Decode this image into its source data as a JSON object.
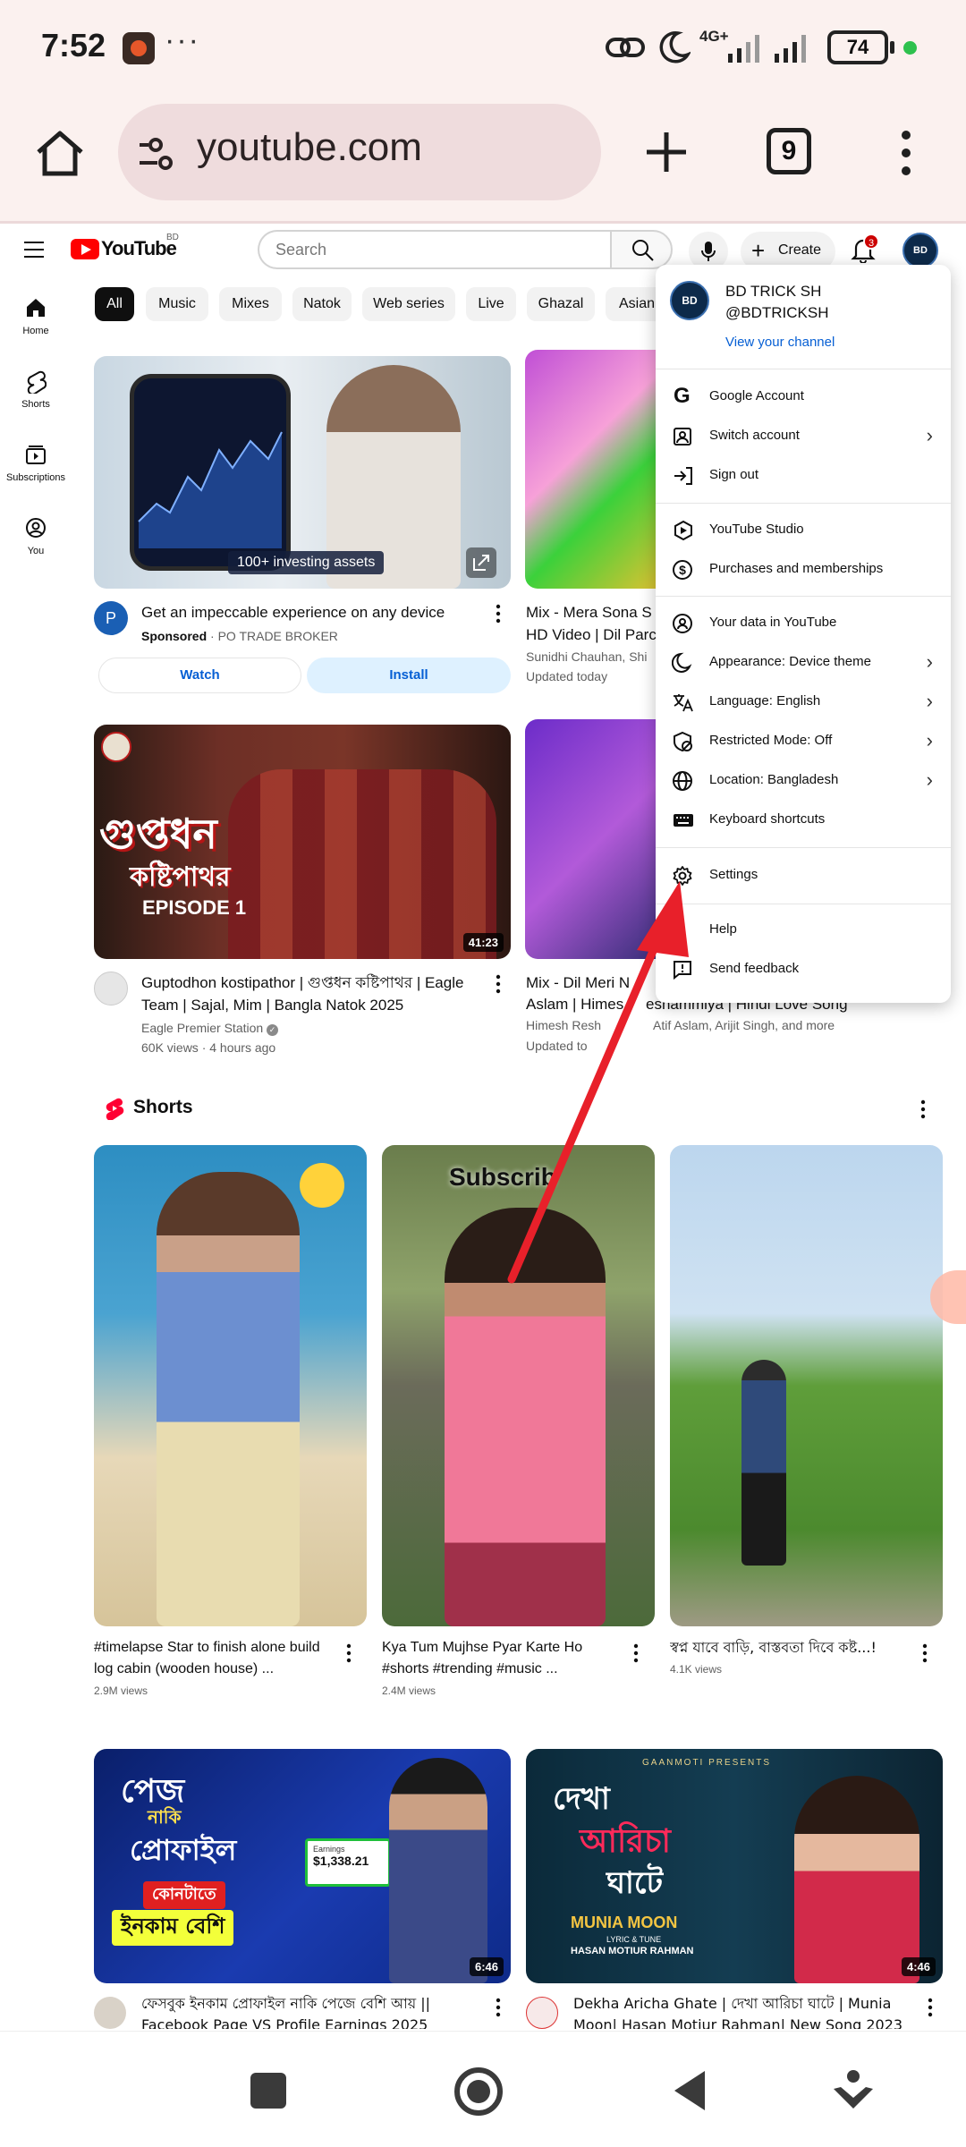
{
  "status": {
    "time": "7:52",
    "dots": "···",
    "network": "4G+",
    "battery": "74"
  },
  "chrome": {
    "url": "youtube.com",
    "tab_count": "9"
  },
  "yt": {
    "brand": "YouTube",
    "region": "BD",
    "search_placeholder": "Search",
    "create_label": "Create",
    "notif_count": "3",
    "avatar_text": "BD",
    "colors": {
      "brand_red": "#ff0000",
      "link_blue": "#065fd4",
      "arrow_red": "#e8202a"
    }
  },
  "sidenav": [
    {
      "label": "Home"
    },
    {
      "label": "Shorts"
    },
    {
      "label": "Subscriptions"
    },
    {
      "label": "You"
    }
  ],
  "chips": [
    "All",
    "Music",
    "Mixes",
    "Natok",
    "Web series",
    "Live",
    "Ghazal",
    "Asian"
  ],
  "videos": {
    "ad": {
      "thumb_caption": "100+ investing assets",
      "title": "Get an impeccable experience on any device",
      "sponsored": "Sponsored",
      "advertiser": "PO TRADE BROKER",
      "channel_initial": "P",
      "watch": "Watch",
      "install": "Install"
    },
    "mix1": {
      "title_l1": "Mix - Mera Sona S",
      "title_l2": "HD Video | Dil Parc",
      "meta_l1": "Sunidhi Chauhan, Shi",
      "meta_l2": "Updated today"
    },
    "natok": {
      "thumb_title": "গুপ্তধন",
      "thumb_sub": "কষ্টিপাথর",
      "episode": "EPISODE 1",
      "duration": "41:23",
      "title": "Guptodhon kostipathor | গুপ্তধন কষ্টিপাথর | Eagle Team | Sajal, Mim | Bangla Natok 2025",
      "channel": "Eagle Premier Station",
      "meta": "60K views · 4 hours ago"
    },
    "mix2": {
      "title_l1": "Mix - Dil Meri N",
      "title_l2": "Aslam | Himes",
      "title_tail": "eshammiya | Hindi Love Song",
      "meta_l1": "Himesh Resh",
      "meta_l1_tail": "Atif Aslam, Arijit Singh, and more",
      "meta_l2": "Updated to"
    }
  },
  "shorts": {
    "heading": "Shorts",
    "items": [
      {
        "title": "#timelapse Star to finish alone build log cabin (wooden house) ...",
        "views": "2.9M views"
      },
      {
        "title": "Kya Tum Mujhse Pyar Karte Ho #shorts #trending #music ...",
        "views": "2.4M views",
        "overlay": "Subscrib"
      },
      {
        "title": "স্বপ্ন যাবে বাড়ি, বাস্তবতা দিবে কষ্ট...!",
        "views": "4.1K views"
      }
    ]
  },
  "bottom_videos": [
    {
      "thumb_l1": "পেজ",
      "thumb_l2": "নাকি",
      "thumb_l3": "প্রোফাইল",
      "thumb_l4": "কোনটাতে",
      "thumb_l5": "ইনকাম বেশি",
      "earnings_label": "Earnings",
      "earnings": "$1,338.21",
      "duration": "6:46",
      "title_l1": "ফেসবুক ইনকাম প্রোফাইল নাকি পেজে বেশি আয় ||",
      "title_l2": "Facebook Page VS Profile Earnings 2025"
    },
    {
      "presents": "GAANMOTI PRESENTS",
      "thumb_l1": "দেখা",
      "thumb_l2": "আরিচা",
      "thumb_l3": "ঘাটে",
      "artist": "MUNIA MOON",
      "credit_label": "LYRIC & TUNE",
      "credit": "HASAN MOTIUR RAHMAN",
      "duration": "4:46",
      "title_l1": "Dekha Aricha Ghate | দেখা আরিচা ঘাটে | Munia",
      "title_l2": "Moon| Hasan Motiur Rahman| New Song 2023"
    }
  ],
  "account_menu": {
    "name": "BD TRICK SH",
    "handle": "@BDTRICKSH",
    "view_channel": "View your channel",
    "items": [
      {
        "label": "Google Account",
        "icon": "google-icon",
        "chev": false
      },
      {
        "label": "Switch account",
        "icon": "switch-account-icon",
        "chev": true
      },
      {
        "label": "Sign out",
        "icon": "sign-out-icon",
        "chev": false
      },
      {
        "label": "YouTube Studio",
        "icon": "studio-icon",
        "chev": false
      },
      {
        "label": "Purchases and memberships",
        "icon": "dollar-icon",
        "chev": false
      },
      {
        "label": "Your data in YouTube",
        "icon": "shield-person-icon",
        "chev": false
      },
      {
        "label": "Appearance: Device theme",
        "icon": "moon-icon",
        "chev": true
      },
      {
        "label": "Language: English",
        "icon": "translate-icon",
        "chev": true
      },
      {
        "label": "Restricted Mode: Off",
        "icon": "restricted-icon",
        "chev": true
      },
      {
        "label": "Location: Bangladesh",
        "icon": "globe-icon",
        "chev": true
      },
      {
        "label": "Keyboard shortcuts",
        "icon": "keyboard-icon",
        "chev": false
      },
      {
        "label": "Settings",
        "icon": "gear-icon",
        "chev": false
      },
      {
        "label": "Help",
        "icon": "help-icon",
        "chev": false
      },
      {
        "label": "Send feedback",
        "icon": "feedback-icon",
        "chev": false
      }
    ]
  }
}
